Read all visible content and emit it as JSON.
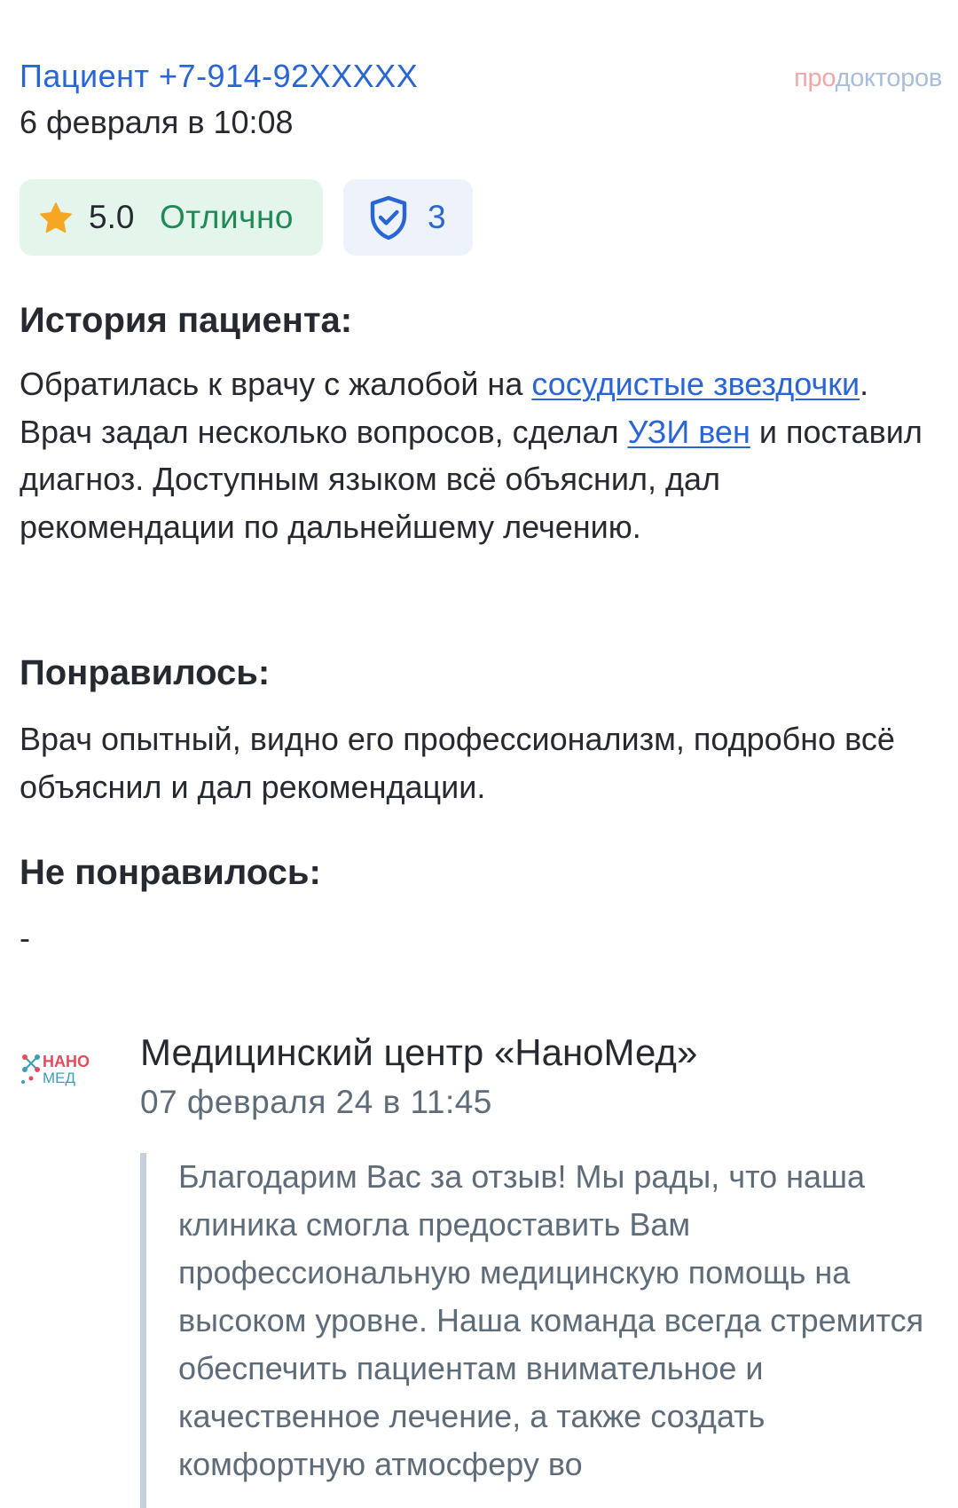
{
  "review": {
    "author": "Пациент +7-914-92XXXXX",
    "date": "6 февраля в 10:08",
    "brand_pro": "про",
    "brand_rest": "докторов",
    "rating": {
      "score": "5.0",
      "verdict": "Отлично",
      "color": "#f5a623"
    },
    "verified_count": "3"
  },
  "history": {
    "title": "История пациента:",
    "text_before": "Обратилась к врачу с жалобой на ",
    "link1": "сосудистые звездочки",
    "text_middle": ". Врач задал несколько вопросов, сделал ",
    "link2": "УЗИ вен",
    "text_after": " и поставил диагноз. Доступным языком всё объяснил, дал рекомендации по дальнейшему лечению."
  },
  "liked": {
    "title": "Понравилось:",
    "text": "Врач опытный, видно его профессионализм, подробно всё объяснил и дал рекомендации."
  },
  "disliked": {
    "title": "Не понравилось:",
    "text": "-"
  },
  "reply": {
    "logo_icon": "nanomed-logo-icon",
    "logo_text_top": "НАНО",
    "logo_text_bottom": "МЕД",
    "clinic_name": "Медицинский центр «НаноМед»",
    "date": "07 февраля 24 в 11:45",
    "text": "Благодарим Вас за отзыв! Мы рады, что наша клиника смогла предоставить Вам профессиональную медицинскую помощь на высоком уровне. Наша команда всегда стремится обеспечить пациентам внимательное и качественное лечение, а также создать комфортную атмосферу во"
  },
  "colors": {
    "link": "#2966d4",
    "rating_bg": "#e4f5ec",
    "rating_text": "#1f8a55",
    "verify_bg": "#eef3fb"
  }
}
